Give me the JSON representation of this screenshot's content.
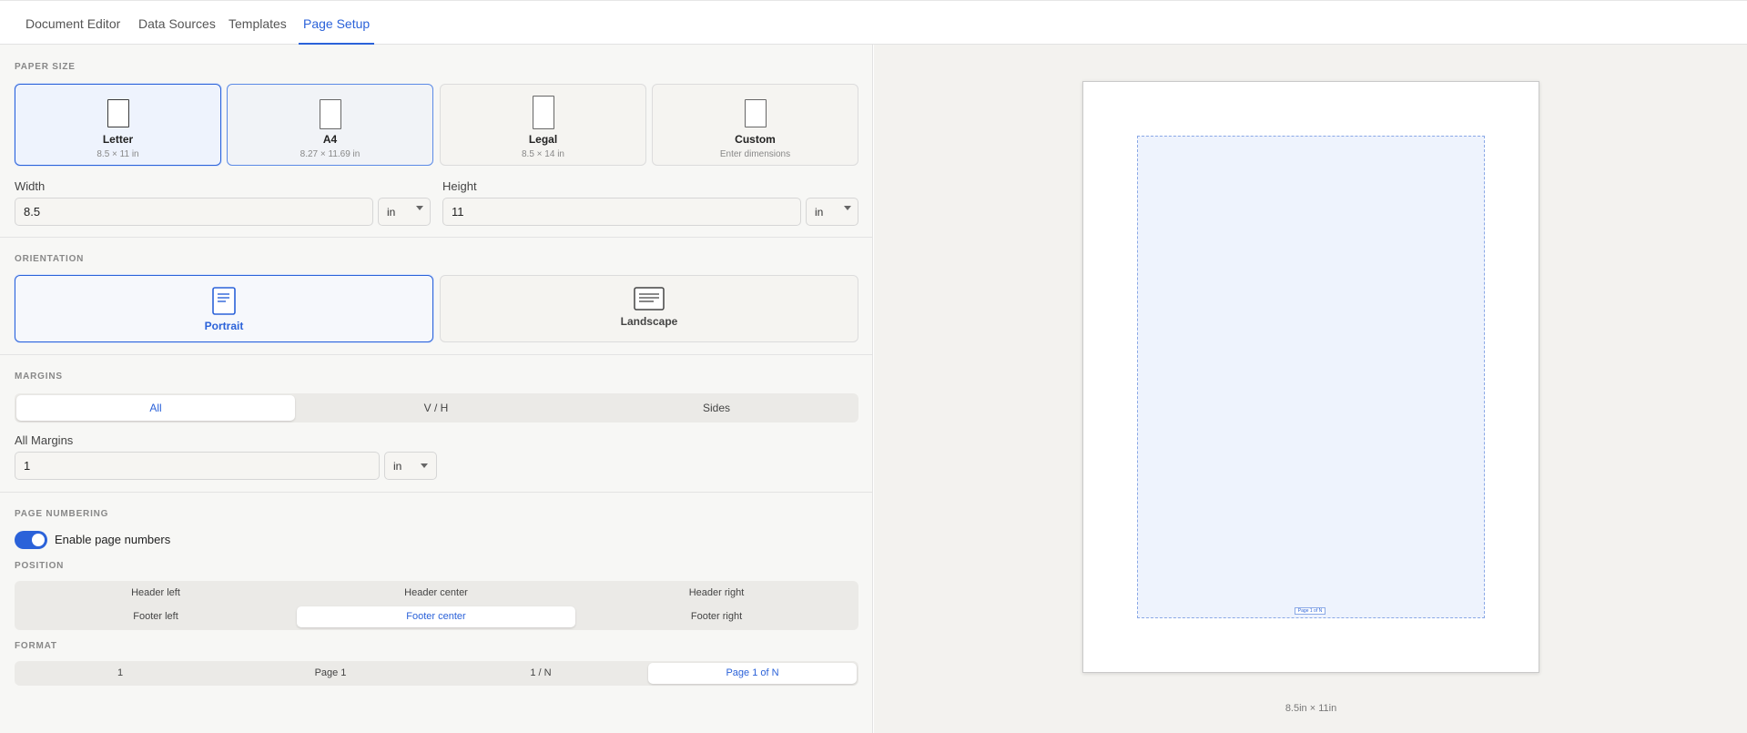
{
  "tabs": [
    {
      "label": "Document Editor"
    },
    {
      "label": "Data Sources"
    },
    {
      "label": "Templates"
    },
    {
      "label": "Page Setup",
      "active": true
    }
  ],
  "paper_size": {
    "title": "PAPER SIZE",
    "options": [
      {
        "name": "Letter",
        "sub": "8.5 × 11 in",
        "selected": true
      },
      {
        "name": "A4",
        "sub": "8.27 × 11.69 in"
      },
      {
        "name": "Legal",
        "sub": "8.5 × 14 in"
      },
      {
        "name": "Custom",
        "sub": "Enter dimensions"
      }
    ],
    "width_label": "Width",
    "width_value": "8.5",
    "width_unit": "in",
    "height_label": "Height",
    "height_value": "11",
    "height_unit": "in"
  },
  "orientation": {
    "title": "ORIENTATION",
    "options": [
      {
        "label": "Portrait",
        "selected": true
      },
      {
        "label": "Landscape"
      }
    ]
  },
  "margins": {
    "title": "MARGINS",
    "modes": [
      {
        "label": "All",
        "active": true
      },
      {
        "label": "V / H"
      },
      {
        "label": "Sides"
      }
    ],
    "all_label": "All Margins",
    "all_value": "1",
    "all_unit": "in"
  },
  "page_numbering": {
    "title": "PAGE NUMBERING",
    "enable_label": "Enable page numbers",
    "enabled": true,
    "position_title": "POSITION",
    "positions": [
      {
        "label": "Header left"
      },
      {
        "label": "Header center"
      },
      {
        "label": "Header right"
      },
      {
        "label": "Footer left"
      },
      {
        "label": "Footer center",
        "active": true
      },
      {
        "label": "Footer right"
      }
    ],
    "format_title": "FORMAT",
    "formats": [
      {
        "label": "1"
      },
      {
        "label": "Page 1"
      },
      {
        "label": "1 / N"
      },
      {
        "label": "Page 1 of N",
        "active": true
      }
    ]
  },
  "preview": {
    "page_number_text": "Page 1 of N",
    "caption": "8.5in × 11in"
  },
  "colors": {
    "accent": "#2b62d9",
    "selected_bg": "#eef3fd",
    "panel_bg": "#f7f7f5",
    "preview_bg": "#f3f2ef"
  }
}
